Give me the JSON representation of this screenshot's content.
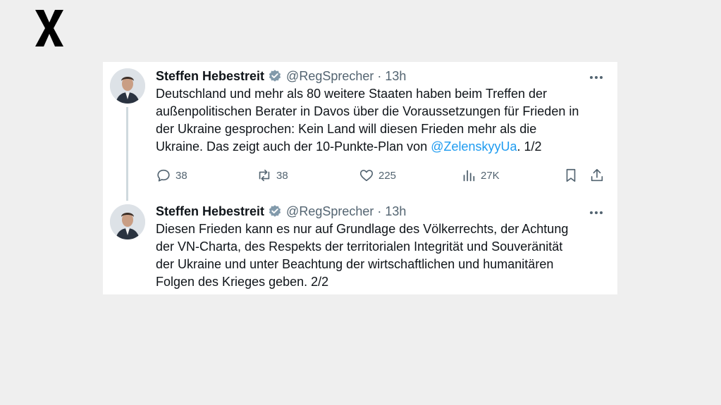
{
  "logo": {
    "icon": "x-logo-icon"
  },
  "tweets": [
    {
      "name": "Steffen Hebestreit",
      "handle": "@RegSprecher",
      "separator": "·",
      "time": "13h",
      "lines": [
        "Deutschland und mehr als 80 weitere Staaten haben beim Treffen der",
        "außenpolitischen Berater in Davos über die Voraussetzungen für Frieden in",
        "der Ukraine gesprochen: Kein Land will diesen Frieden mehr als die"
      ],
      "last_line_before": "Ukraine. Das zeigt auch der 10-Punkte-Plan von ",
      "mention": "@ZelenskyyUa",
      "last_line_after": ". 1/2",
      "replies": "38",
      "reposts": "38",
      "likes": "225",
      "views": "27K"
    },
    {
      "name": "Steffen Hebestreit",
      "handle": "@RegSprecher",
      "separator": "·",
      "time": "13h",
      "lines": [
        "Diesen Frieden kann es nur auf Grundlage des Völkerrechts, der Achtung",
        "der VN-Charta, des Respekts der territorialen Integrität und Souveränität",
        "der Ukraine und unter Beachtung der wirtschaftlichen und humanitären",
        "Folgen des Krieges geben. 2/2"
      ]
    }
  ],
  "colors": {
    "accent": "#1d9bf0",
    "verified": "#829aab",
    "text": "#0f1419",
    "muted": "#536471"
  }
}
